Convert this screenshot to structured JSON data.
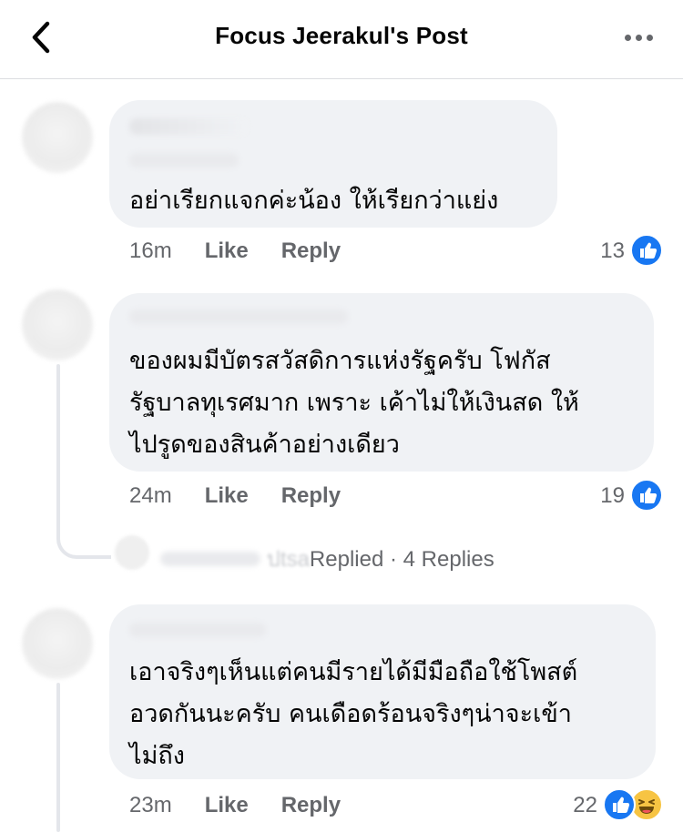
{
  "header": {
    "title": "Focus Jeerakul's Post"
  },
  "comments": [
    {
      "text_lines": [
        "อย่าเรียกแจกค่ะน้อง ให้เรียกว่าแย่ง"
      ],
      "time": "16m",
      "like_label": "Like",
      "reply_label": "Reply",
      "reaction_count": "13",
      "reactions": [
        "like-icon"
      ]
    },
    {
      "text_lines": [
        "ของผมมีบัตรสวัสดิการแห่งรัฐครับ โฟกัส",
        "รัฐบาลทุเรศมาก เพราะ เค้าไม่ให้เงินสด ให้",
        "ไปรูดของสินค้าอย่างเดียว"
      ],
      "time": "24m",
      "like_label": "Like",
      "reply_label": "Reply",
      "reaction_count": "19",
      "reactions": [
        "like-icon"
      ],
      "replies_summary": {
        "replied_label": "Replied",
        "replies_count": "4 Replies",
        "partial_name": "ปtsa"
      }
    },
    {
      "text_lines": [
        "เอาจริงๆเห็นแต่คนมีรายได้มีมือถือใช้โพสต์",
        "อวดกันนะครับ คนเดือดร้อนจริงๆน่าจะเข้า",
        "ไม่ถึง"
      ],
      "time": "23m",
      "like_label": "Like",
      "reply_label": "Reply",
      "reaction_count": "22",
      "reactions": [
        "like-icon",
        "haha-icon"
      ]
    }
  ],
  "colors": {
    "bubble": "#f0f2f5",
    "meta_text": "#65676b",
    "like_blue": "#1877f2",
    "haha_yellow": "#f7c443"
  }
}
